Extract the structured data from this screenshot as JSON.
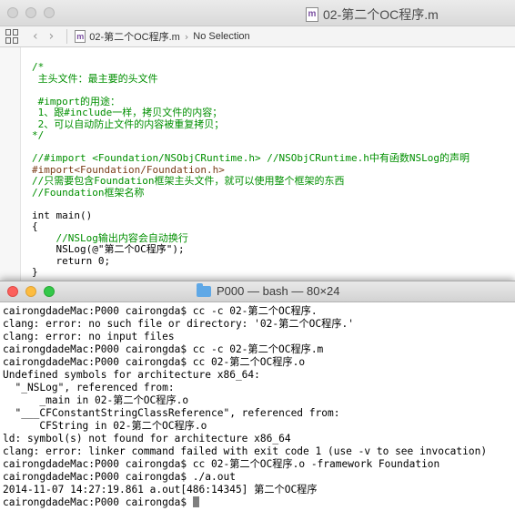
{
  "xcode": {
    "window_title": "02-第二个OC程序.m",
    "file_icon_letter": "m",
    "jumpbar": {
      "file_name": "02-第二个OC程序.m",
      "chevron": "›",
      "selection": "No Selection"
    },
    "code_lines": [
      {
        "cls": "c-com",
        "text": "/*"
      },
      {
        "cls": "c-com",
        "text": " 主头文件：最主要的头文件"
      },
      {
        "cls": "c-com",
        "text": ""
      },
      {
        "cls": "c-com",
        "text": " #import的用途："
      },
      {
        "cls": "c-com",
        "text": " 1、跟#include一样，拷贝文件的内容；"
      },
      {
        "cls": "c-com",
        "text": " 2、可以自动防止文件的内容被重复拷贝；"
      },
      {
        "cls": "c-com",
        "text": "*/"
      },
      {
        "cls": "c-com",
        "text": ""
      },
      {
        "cls": "c-com",
        "text": "//#import <Foundation/NSObjCRuntime.h> //NSObjCRuntime.h中有函数NSLog的声明"
      },
      {
        "cls": "c-pre",
        "text": "#import<Foundation/Foundation.h>"
      },
      {
        "cls": "c-com",
        "text": "//只需要包含Foundation框架主头文件，就可以使用整个框架的东西"
      },
      {
        "cls": "c-com",
        "text": "//Foundation框架名称"
      },
      {
        "cls": "c-pln",
        "text": ""
      },
      {
        "cls": "c-pln",
        "text": "int main()"
      },
      {
        "cls": "c-pln",
        "text": "{"
      },
      {
        "cls": "c-com",
        "text": "    //NSLog输出内容会自动换行"
      },
      {
        "cls": "c-pln",
        "text": "    NSLog(@\"第二个OC程序\");"
      },
      {
        "cls": "c-pln",
        "text": "    return 0;"
      },
      {
        "cls": "c-pln",
        "text": "}"
      }
    ]
  },
  "terminal": {
    "title": "P000 — bash — 80×24",
    "lines": [
      "cairongdadeMac:P000 cairongda$ cc -c 02-第二个OC程序.",
      "clang: error: no such file or directory: '02-第二个OC程序.'",
      "clang: error: no input files",
      "cairongdadeMac:P000 cairongda$ cc -c 02-第二个OC程序.m",
      "cairongdadeMac:P000 cairongda$ cc 02-第二个OC程序.o",
      "Undefined symbols for architecture x86_64:",
      "  \"_NSLog\", referenced from:",
      "      _main in 02-第二个OC程序.o",
      "  \"___CFConstantStringClassReference\", referenced from:",
      "      CFString in 02-第二个OC程序.o",
      "ld: symbol(s) not found for architecture x86_64",
      "clang: error: linker command failed with exit code 1 (use -v to see invocation)",
      "cairongdadeMac:P000 cairongda$ cc 02-第二个OC程序.o -framework Foundation",
      "cairongdadeMac:P000 cairongda$ ./a.out",
      "2014-11-07 14:27:19.861 a.out[486:14345] 第二个OC程序"
    ],
    "prompt": "cairongdadeMac:P000 cairongda$ "
  }
}
